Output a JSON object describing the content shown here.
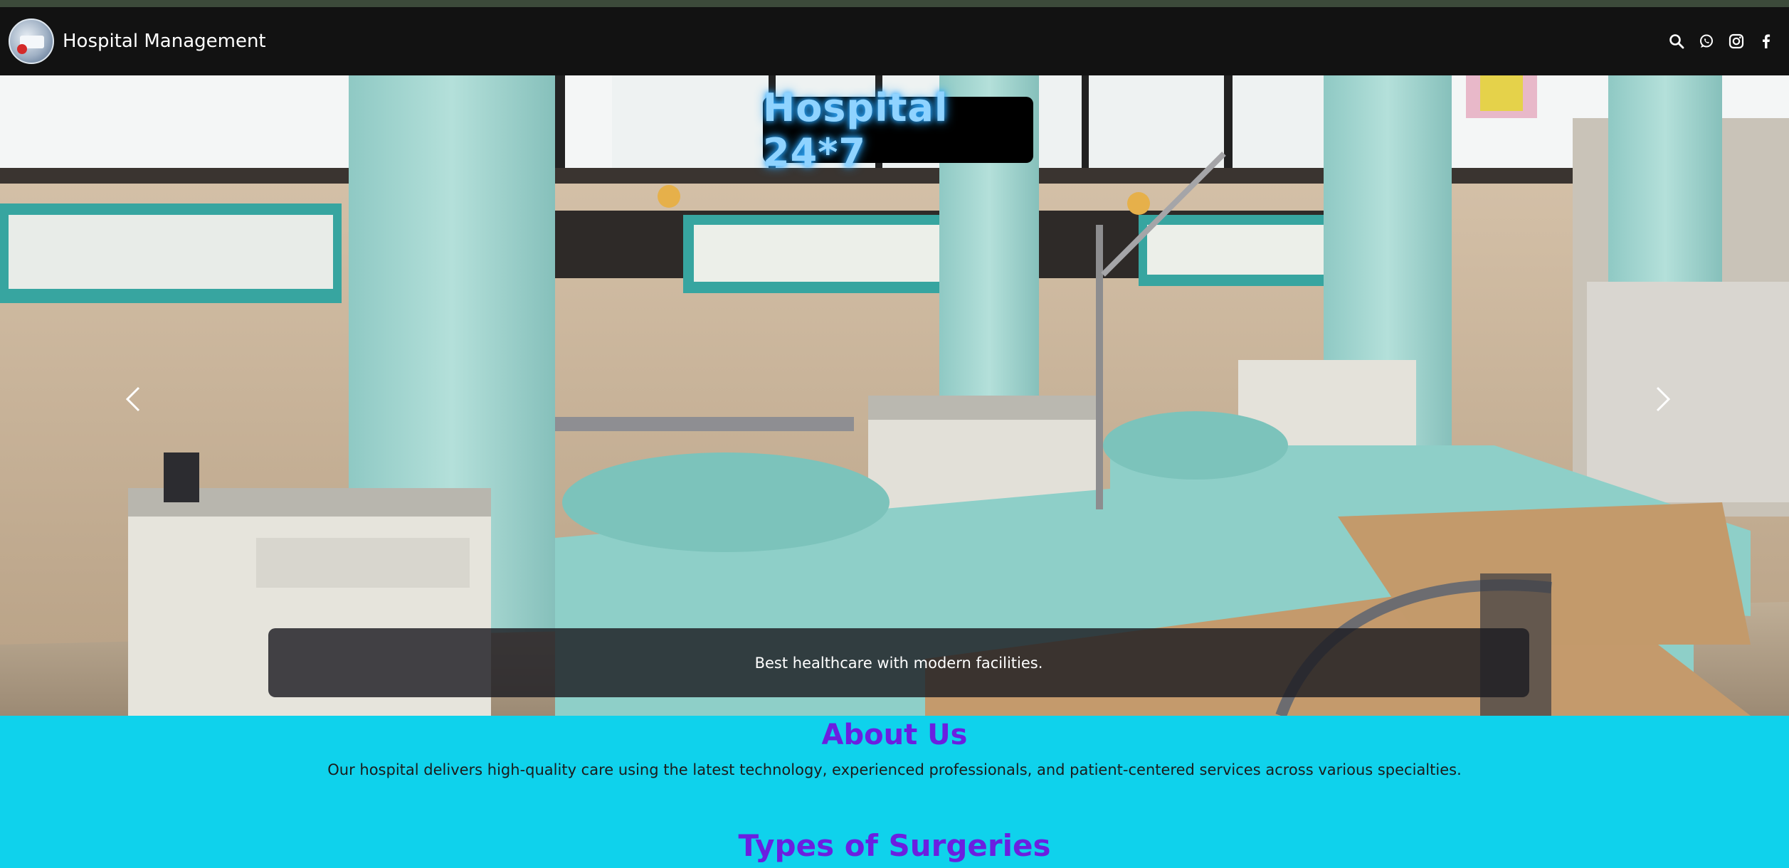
{
  "navbar": {
    "brand_name": "Hospital Management",
    "icons": [
      "search-icon",
      "whatsapp-icon",
      "instagram-icon",
      "facebook-icon"
    ]
  },
  "hero": {
    "title": "Hospital 24*7",
    "caption": "Best healthcare with modern facilities.",
    "prev_label": "Previous",
    "next_label": "Next"
  },
  "about": {
    "title": "About Us",
    "text": "Our hospital delivers high-quality care using the latest technology, experienced professionals, and patient-centered services across various specialties."
  },
  "surgeries": {
    "title": "Types of Surgeries"
  },
  "colors": {
    "navbar_bg": "#121212",
    "section_bg": "#0fd2ec",
    "heading_purple": "#6b1fe0",
    "title_glow": "#8fd3ff"
  }
}
